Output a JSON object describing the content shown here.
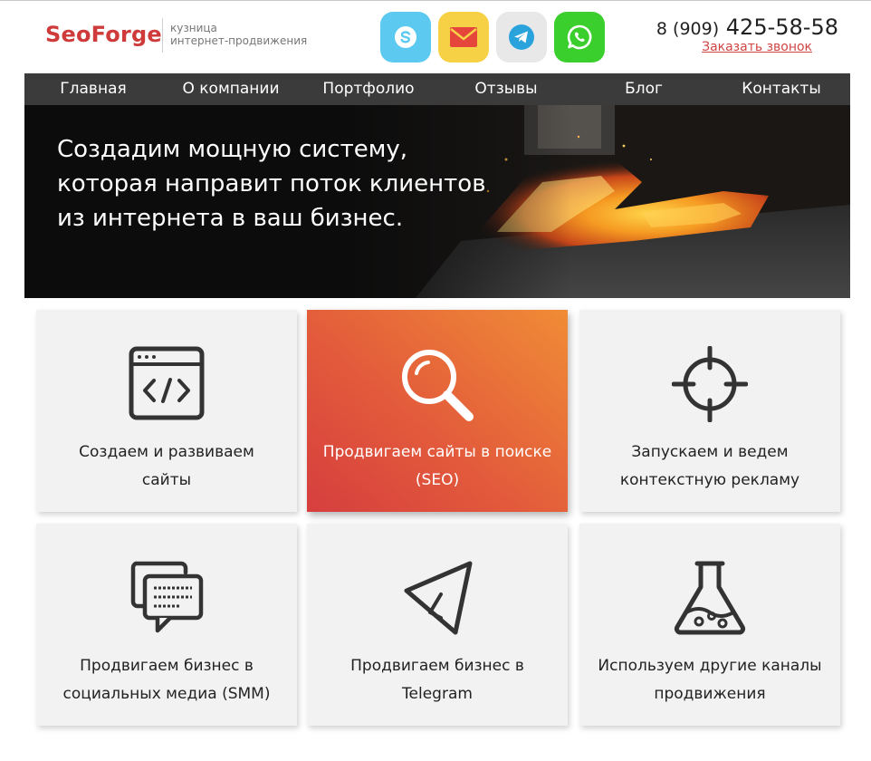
{
  "header": {
    "logo": "SeoForge",
    "tagline_line1": "кузница",
    "tagline_line2": "интернет-продвижения",
    "social": [
      {
        "icon": "skype-icon",
        "color": "#5ccaf0"
      },
      {
        "icon": "mail-icon",
        "color": "#f6d146"
      },
      {
        "icon": "telegram-icon",
        "color": "#e8e8e8"
      },
      {
        "icon": "whatsapp-icon",
        "color": "#3bcf2e"
      }
    ],
    "phone_code": "8 (909)",
    "phone_number": "425-58-58",
    "callback_link": "Заказать звонок"
  },
  "nav": {
    "items": [
      "Главная",
      "О компании",
      "Портфолио",
      "Отзывы",
      "Блог",
      "Контакты"
    ]
  },
  "hero": {
    "title_line1": "Создадим мощную систему,",
    "title_line2": "которая направит поток клиентов",
    "title_line3": "из интернета в ваш бизнес."
  },
  "services": [
    {
      "icon": "code-window-icon",
      "line1": "Создаем и развиваем",
      "line2": "сайты",
      "active": false
    },
    {
      "icon": "magnifier-icon",
      "line1": "Продвигаем сайты в поиске",
      "line2": "(SEO)",
      "active": true
    },
    {
      "icon": "crosshair-icon",
      "line1": "Запускаем и ведем",
      "line2": "контекстную рекламу",
      "active": false
    },
    {
      "icon": "chat-bubbles-icon",
      "line1": "Продвигаем бизнес в",
      "line2": "социальных медиа (SMM)",
      "active": false
    },
    {
      "icon": "telegram-plane-icon",
      "line1": "Продвигаем бизнес в",
      "line2": "Telegram",
      "active": false
    },
    {
      "icon": "flask-icon",
      "line1": "Используем другие каналы",
      "line2": "продвижения",
      "active": false
    }
  ],
  "colors": {
    "brand": "#cf3a3a",
    "nav_bg": "#3b3b3b",
    "card_bg": "#f2f2f2",
    "active_gradient_start": "#d63e3e",
    "active_gradient_end": "#f08c36"
  }
}
